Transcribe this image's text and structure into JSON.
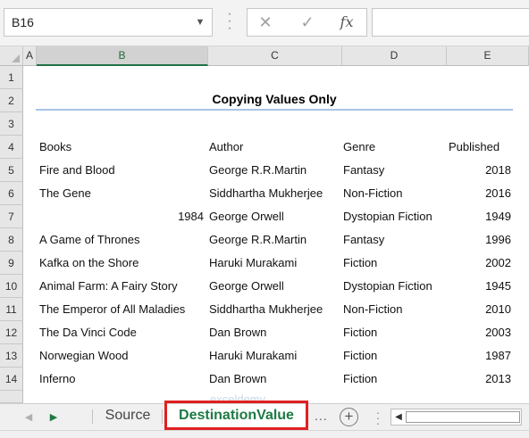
{
  "namebox": {
    "value": "B16"
  },
  "formula_bar": {
    "cancel_icon": "✕",
    "enter_icon": "✓",
    "fx_label": "fx",
    "value": ""
  },
  "columns": [
    {
      "id": "A",
      "label": "A",
      "selected": false
    },
    {
      "id": "B",
      "label": "B",
      "selected": true
    },
    {
      "id": "C",
      "label": "C",
      "selected": false
    },
    {
      "id": "D",
      "label": "D",
      "selected": false
    },
    {
      "id": "E",
      "label": "E",
      "selected": false
    }
  ],
  "rows": [
    "1",
    "2",
    "3",
    "4",
    "5",
    "6",
    "7",
    "8",
    "9",
    "10",
    "11",
    "12",
    "13",
    "14"
  ],
  "sheet": {
    "title": "Copying Values Only",
    "headers": {
      "books": "Books",
      "author": "Author",
      "genre": "Genre",
      "published": "Published"
    },
    "data": [
      {
        "book": "Fire and Blood",
        "author": "George R.R.Martin",
        "genre": "Fantasy",
        "published": "2018"
      },
      {
        "book": "The Gene",
        "author": "Siddhartha Mukherjee",
        "genre": "Non-Fiction",
        "published": "2016"
      },
      {
        "book": "1984",
        "author": "George Orwell",
        "genre": "Dystopian Fiction",
        "published": "1949"
      },
      {
        "book": "A Game of Thrones",
        "author": "George R.R.Martin",
        "genre": "Fantasy",
        "published": "1996"
      },
      {
        "book": "Kafka on the Shore",
        "author": "Haruki Murakami",
        "genre": "Fiction",
        "published": "2002"
      },
      {
        "book": "Animal Farm: A Fairy Story",
        "author": "George Orwell",
        "genre": "Dystopian Fiction",
        "published": "1945"
      },
      {
        "book": "The Emperor of All Maladies",
        "author": "Siddhartha Mukherjee",
        "genre": "Non-Fiction",
        "published": "2010"
      },
      {
        "book": "The Da Vinci Code",
        "author": "Dan Brown",
        "genre": "Fiction",
        "published": "2003"
      },
      {
        "book": "Norwegian Wood",
        "author": "Haruki Murakami",
        "genre": "Fiction",
        "published": "1987"
      },
      {
        "book": "Inferno",
        "author": "Dan Brown",
        "genre": "Fiction",
        "published": "2013"
      }
    ]
  },
  "tabs": {
    "items": [
      {
        "label": "Source",
        "active": false
      },
      {
        "label": "DestinationValue",
        "active": true
      }
    ],
    "more": "...",
    "add": "+"
  },
  "watermark": "exceldemy",
  "colors": {
    "accent": "#217346",
    "highlight": "#e02020",
    "title_rule": "#a9c4e4"
  }
}
